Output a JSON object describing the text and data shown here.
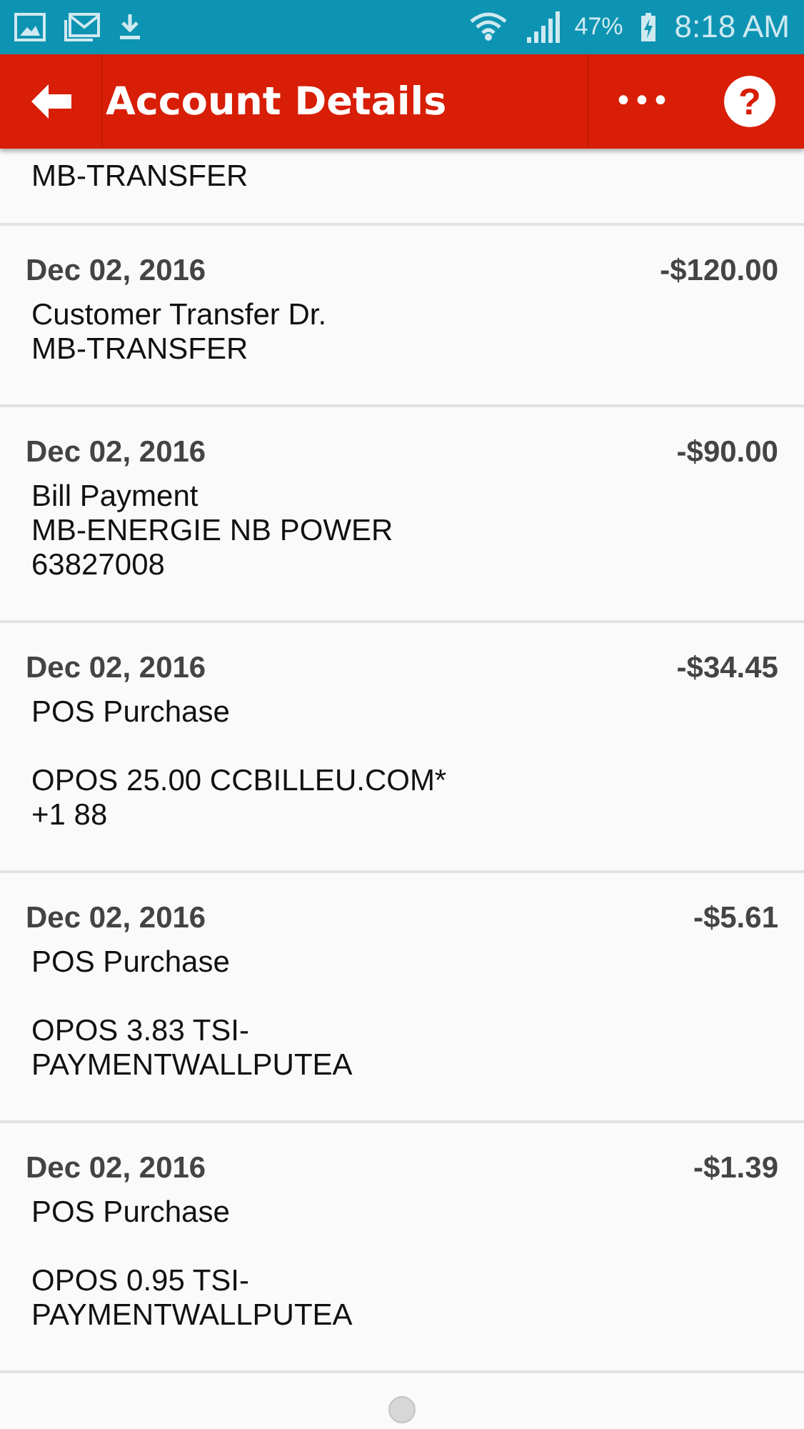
{
  "status_bar": {
    "battery": "47%",
    "time": "8:18 AM"
  },
  "header": {
    "title": "Account Details",
    "more": "•••",
    "help": "?"
  },
  "partial_row": {
    "lines": [
      "MB-TRANSFER"
    ]
  },
  "transactions": [
    {
      "date": "Dec 02, 2016",
      "amount": "-$120.00",
      "lines": [
        "Customer Transfer Dr.",
        "MB-TRANSFER"
      ]
    },
    {
      "date": "Dec 02, 2016",
      "amount": "-$90.00",
      "lines": [
        "Bill Payment",
        "MB-ENERGIE NB POWER",
        "63827008"
      ]
    },
    {
      "date": "Dec 02, 2016",
      "amount": "-$34.45",
      "lines": [
        "POS Purchase"
      ],
      "details": [
        "OPOS 25.00 CCBILLEU.COM*",
        "+1 88"
      ]
    },
    {
      "date": "Dec 02, 2016",
      "amount": "-$5.61",
      "lines": [
        "POS Purchase"
      ],
      "details": [
        "OPOS 3.83 TSI-",
        "PAYMENTWALLPUTEA"
      ]
    },
    {
      "date": "Dec 02, 2016",
      "amount": "-$1.39",
      "lines": [
        "POS Purchase"
      ],
      "details": [
        "OPOS 0.95 TSI-",
        "PAYMENTWALLPUTEA"
      ]
    }
  ]
}
